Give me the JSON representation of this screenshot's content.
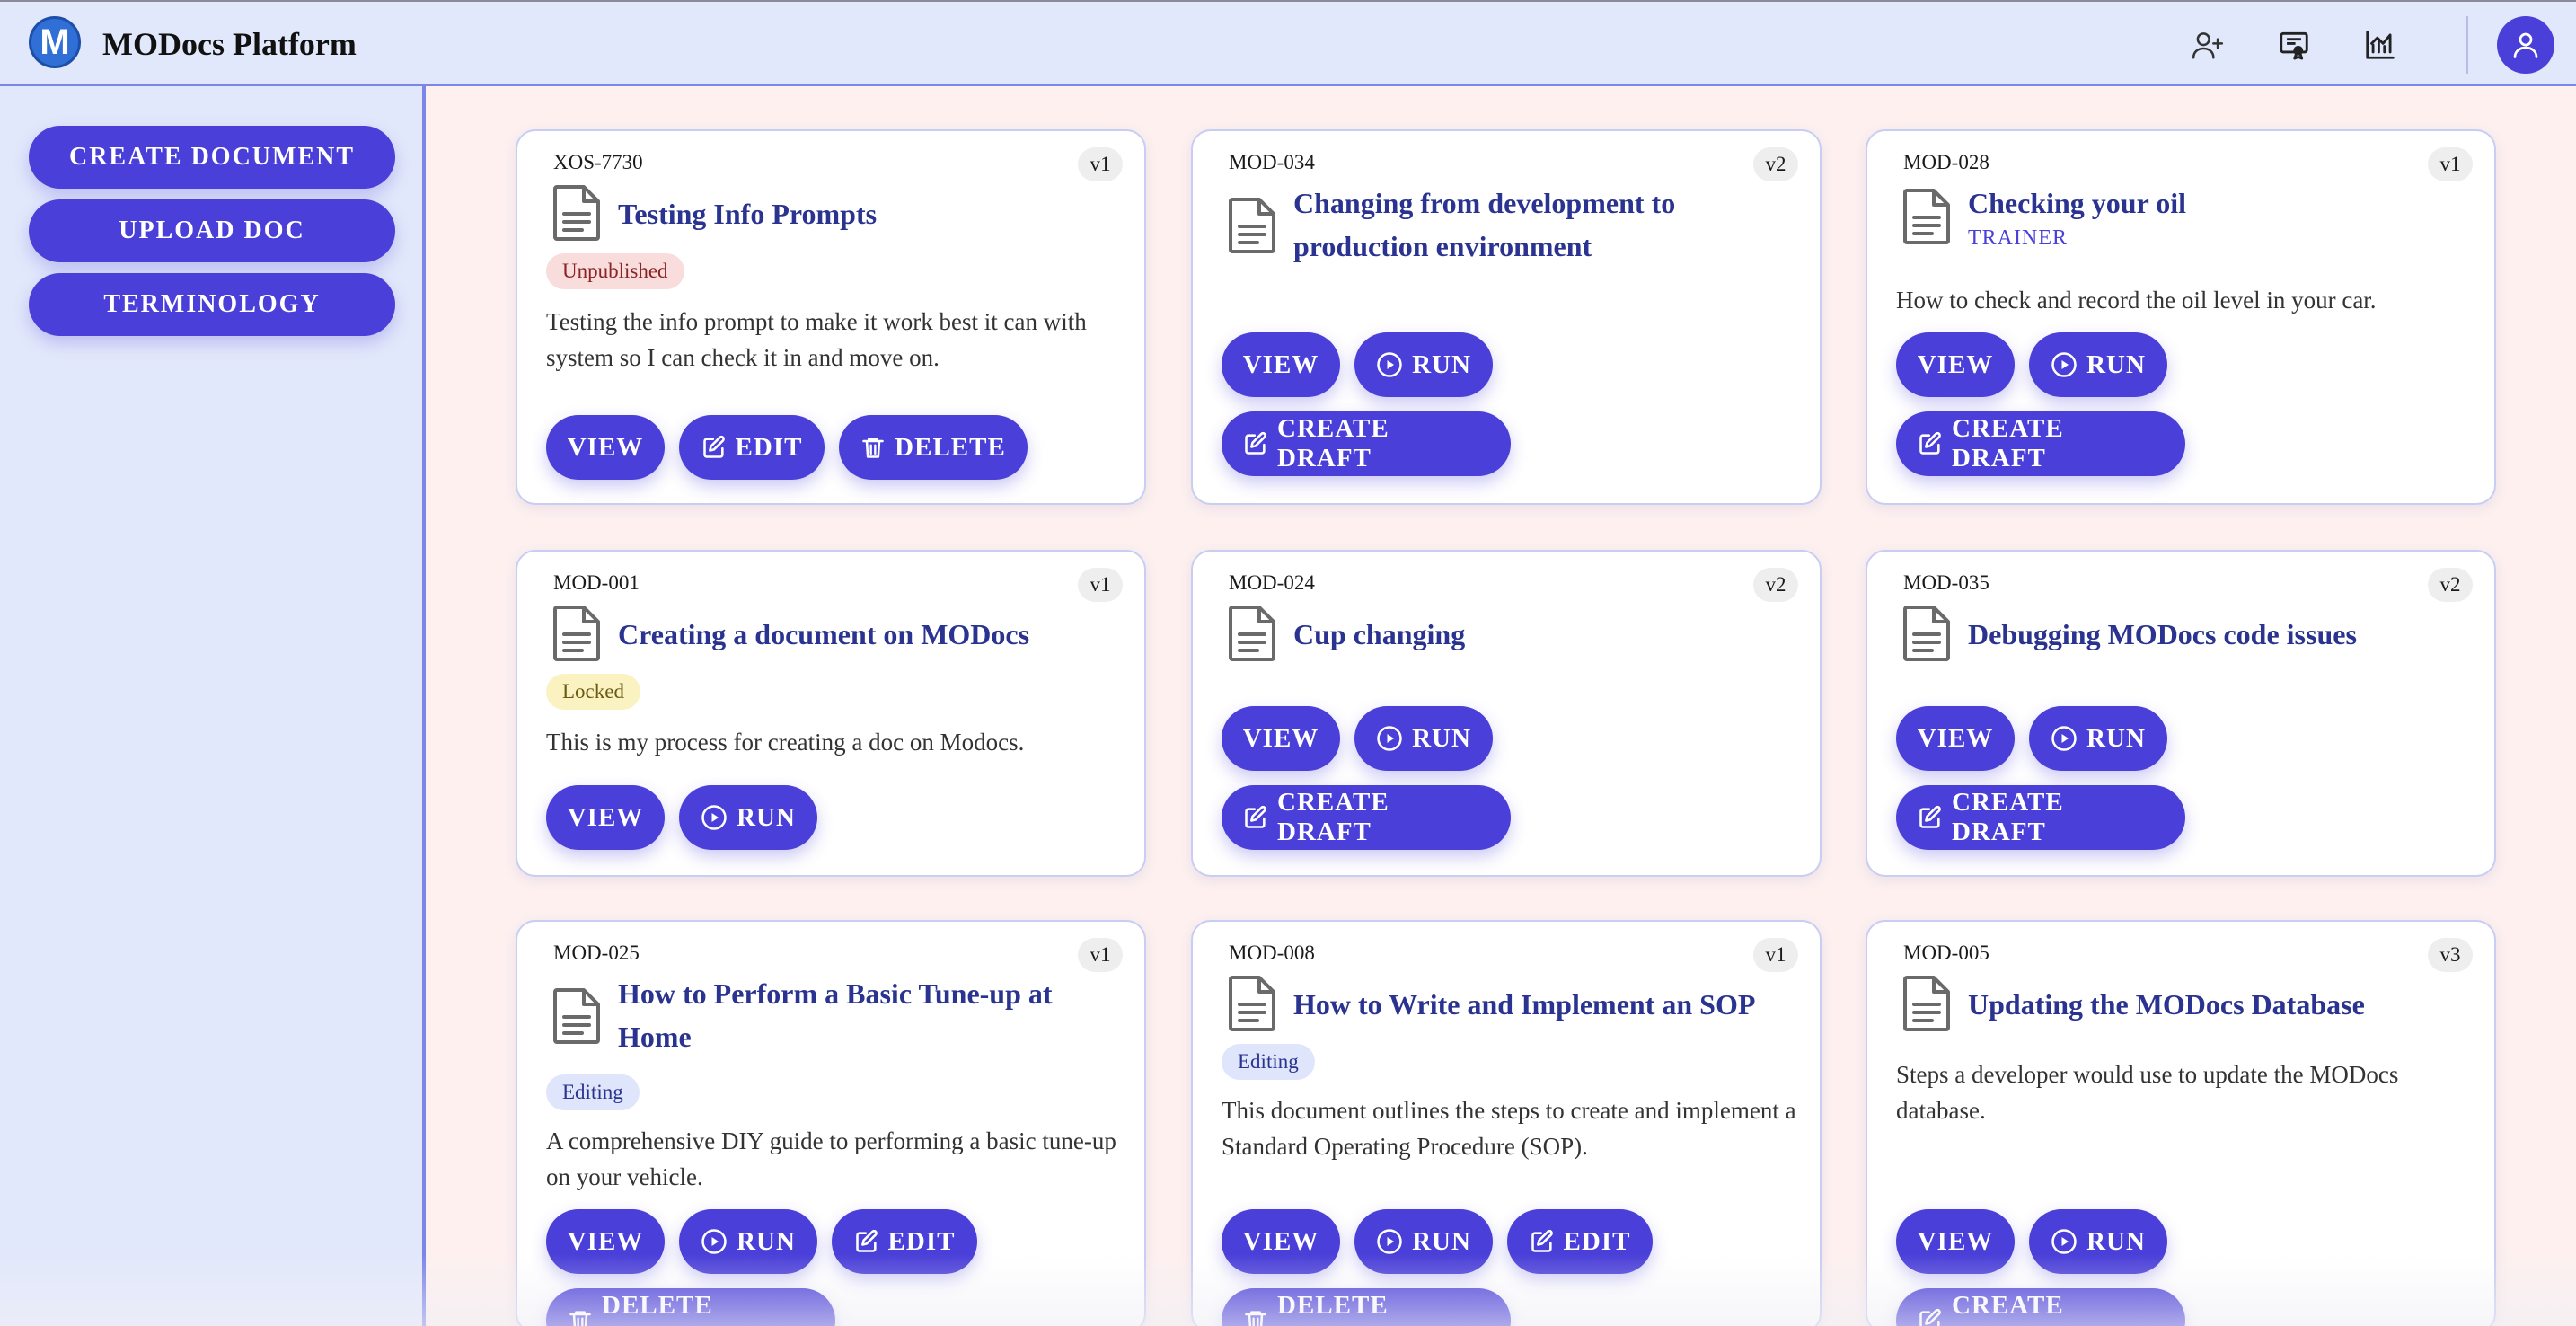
{
  "header": {
    "logo_letter": "M",
    "app_title": "MODocs Platform",
    "icons": [
      "add-user-icon",
      "certificate-icon",
      "analytics-chart-icon"
    ],
    "avatar_icon": "user-icon"
  },
  "sidebar": {
    "buttons": [
      {
        "label": "CREATE DOCUMENT"
      },
      {
        "label": "UPLOAD DOC"
      },
      {
        "label": "TERMINOLOGY"
      }
    ]
  },
  "colors": {
    "primary": "#4a3fd8",
    "title": "#2a3490",
    "background": "#fdf0ef",
    "sidebar": "#e2e8fb"
  },
  "cards": [
    {
      "code": "XOS-7730",
      "version": "v1",
      "title": "Testing Info Prompts",
      "badge": "Unpublished",
      "description": "Testing the info prompt to make it work best it can with system so I can check it in and move on.",
      "buttons": [
        "VIEW",
        "EDIT",
        "DELETE"
      ]
    },
    {
      "code": "MOD-034",
      "version": "v2",
      "title": "Changing from development to production environment",
      "buttons": [
        "VIEW",
        "RUN",
        "CREATE DRAFT"
      ]
    },
    {
      "code": "MOD-028",
      "version": "v1",
      "title": "Checking your oil",
      "subtitle": "TRAINER",
      "description": "How to check and record the oil level in your car.",
      "buttons": [
        "VIEW",
        "RUN",
        "CREATE DRAFT"
      ]
    },
    {
      "code": "MOD-001",
      "version": "v1",
      "title": "Creating a document on MODocs",
      "badge": "Locked",
      "description": "This is my process for creating a doc on Modocs.",
      "buttons": [
        "VIEW",
        "RUN"
      ]
    },
    {
      "code": "MOD-024",
      "version": "v2",
      "title": "Cup changing",
      "buttons": [
        "VIEW",
        "RUN",
        "CREATE DRAFT"
      ]
    },
    {
      "code": "MOD-035",
      "version": "v2",
      "title": "Debugging MODocs code issues",
      "buttons": [
        "VIEW",
        "RUN",
        "CREATE DRAFT"
      ]
    },
    {
      "code": "MOD-025",
      "version": "v1",
      "title": "How to Perform a Basic Tune-up at Home",
      "badge": "Editing",
      "description": "A comprehensive DIY guide to performing a basic tune-up on your vehicle.",
      "buttons": [
        "VIEW",
        "RUN",
        "EDIT",
        "DELETE DRAFT"
      ]
    },
    {
      "code": "MOD-008",
      "version": "v1",
      "title": "How to Write and Implement an SOP",
      "badge": "Editing",
      "description": "This document outlines the steps to create and implement a Standard Operating Procedure (SOP).",
      "buttons": [
        "VIEW",
        "RUN",
        "EDIT",
        "DELETE DRAFT"
      ]
    },
    {
      "code": "MOD-005",
      "version": "v3",
      "title": "Updating the MODocs Database",
      "description": "Steps a developer would use to update the MODocs database.",
      "buttons": [
        "VIEW",
        "RUN",
        "CREATE DRAFT"
      ]
    }
  ]
}
